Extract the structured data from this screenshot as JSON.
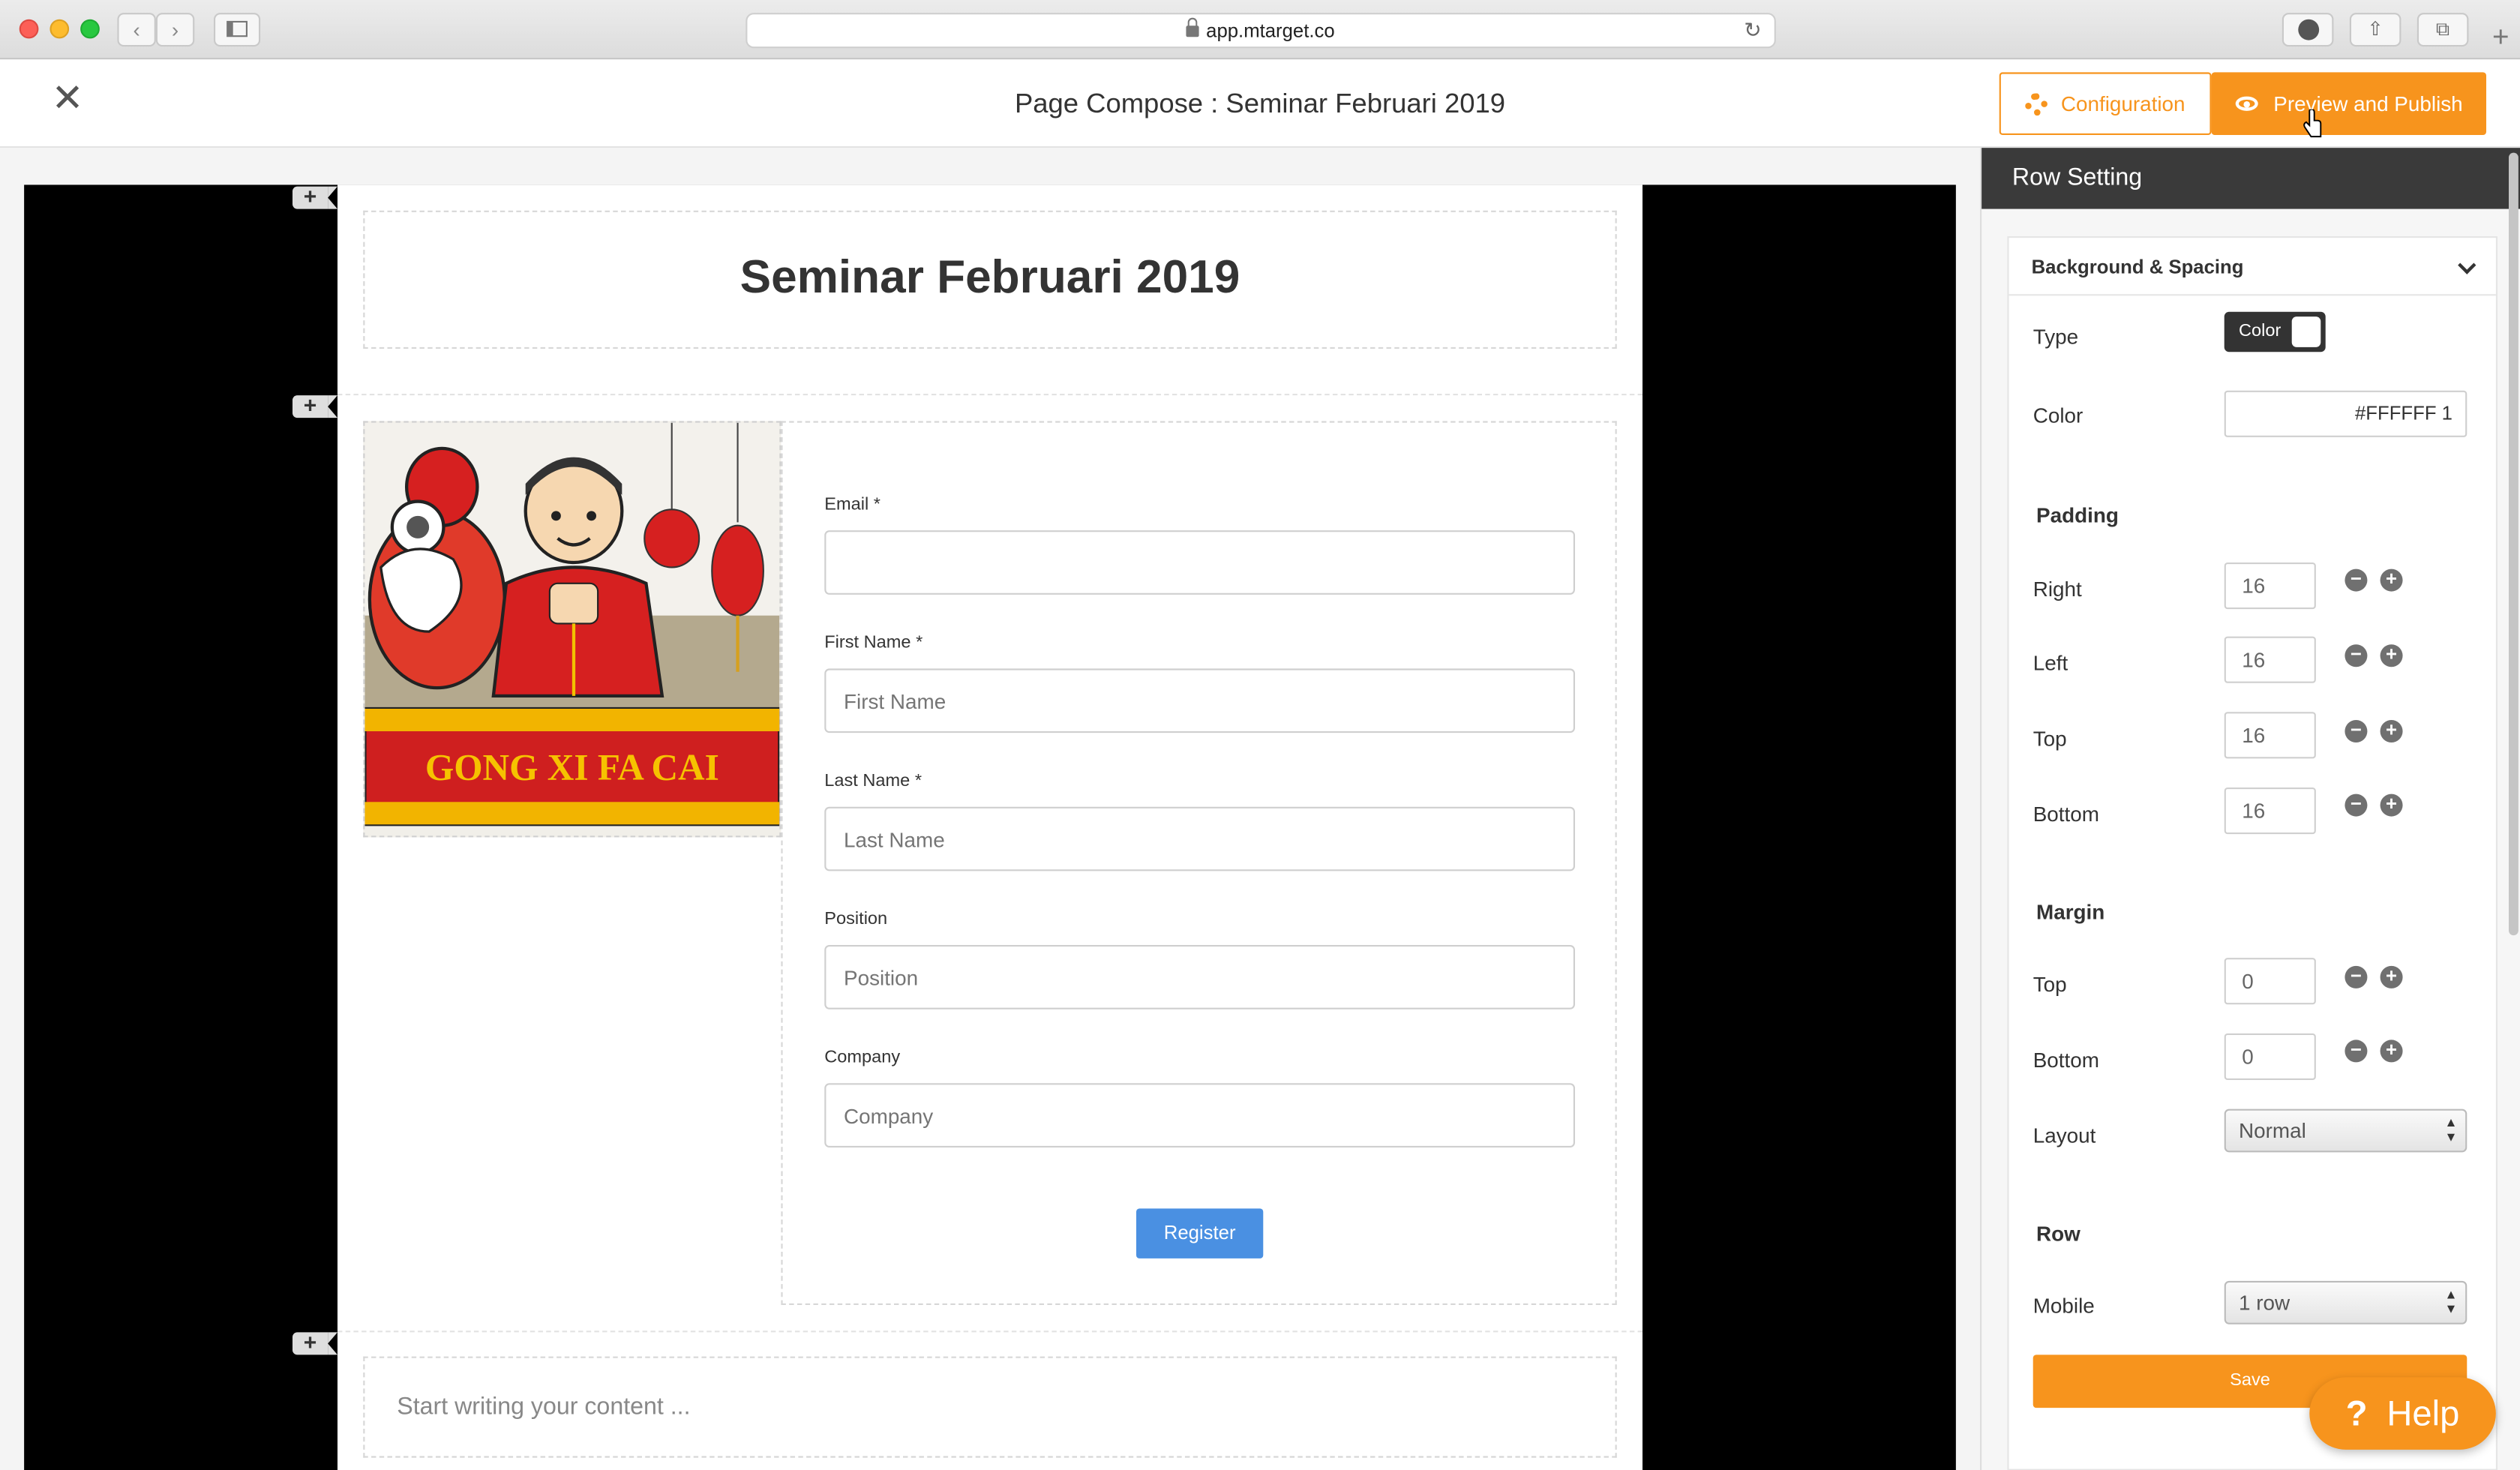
{
  "browser": {
    "url": "app.mtarget.co"
  },
  "header": {
    "title": "Page Compose : Seminar Februari 2019",
    "configuration_label": "Configuration",
    "publish_label": "Preview and Publish"
  },
  "page": {
    "heading": "Seminar Februari 2019",
    "image_banner_text": "GONG XI FA CAI",
    "content_placeholder": "Start writing your content ...",
    "form": {
      "fields": [
        {
          "label": "Email *",
          "placeholder": ""
        },
        {
          "label": "First Name *",
          "placeholder": "First Name"
        },
        {
          "label": "Last Name *",
          "placeholder": "Last Name"
        },
        {
          "label": "Position",
          "placeholder": "Position"
        },
        {
          "label": "Company",
          "placeholder": "Company"
        }
      ],
      "submit_label": "Register"
    }
  },
  "panel": {
    "title": "Row Setting",
    "section_title": "Background & Spacing",
    "type_label": "Type",
    "type_value": "Color",
    "color_label": "Color",
    "color_value": "#FFFFFF 1",
    "padding": {
      "heading": "Padding",
      "right": {
        "label": "Right",
        "value": "16"
      },
      "left": {
        "label": "Left",
        "value": "16"
      },
      "top": {
        "label": "Top",
        "value": "16"
      },
      "bottom": {
        "label": "Bottom",
        "value": "16"
      }
    },
    "margin": {
      "heading": "Margin",
      "top": {
        "label": "Top",
        "value": "0"
      },
      "bottom": {
        "label": "Bottom",
        "value": "0"
      }
    },
    "layout_label": "Layout",
    "layout_value": "Normal",
    "row_heading": "Row",
    "mobile_label": "Mobile",
    "mobile_value": "1 row",
    "save_label": "Save"
  },
  "help": {
    "label": "Help",
    "icon_glyph": "?"
  },
  "colors": {
    "accent": "#f7941d",
    "primary_button": "#4a90e2",
    "panel_header": "#3a3a3a"
  }
}
